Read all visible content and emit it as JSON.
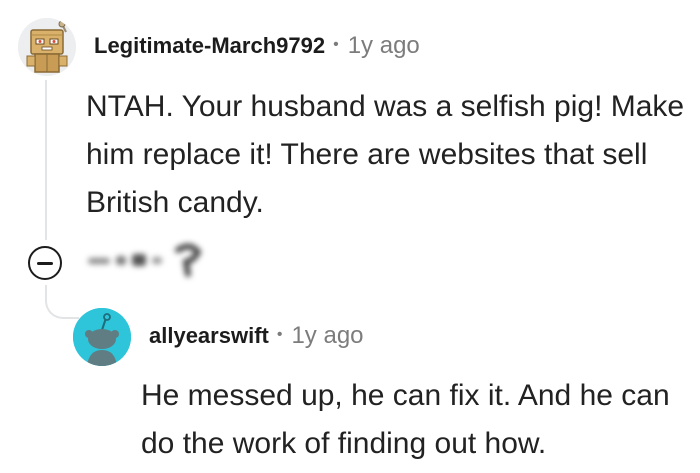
{
  "comment": {
    "avatar_icon": "robot-box-avatar-icon",
    "author": "Legitimate-March9792",
    "separator": "•",
    "age": "1y ago",
    "body": "NTAH. Your husband was a selfish pig! Make him replace it! There are websites that sell British candy."
  },
  "controls": {
    "collapse_icon": "minus-circle-icon",
    "blurred_content": "redacted"
  },
  "reply": {
    "avatar_icon": "snoo-avatar-icon",
    "author": "allyearswift",
    "separator": "•",
    "age": "1y ago",
    "body": "He messed up, he can fix it. And he can do the work of finding out how."
  },
  "colors": {
    "thread_line": "#e2e4e6",
    "meta_gray": "#7c7c7c",
    "reply_avatar_bg": "#2ec4d9"
  }
}
